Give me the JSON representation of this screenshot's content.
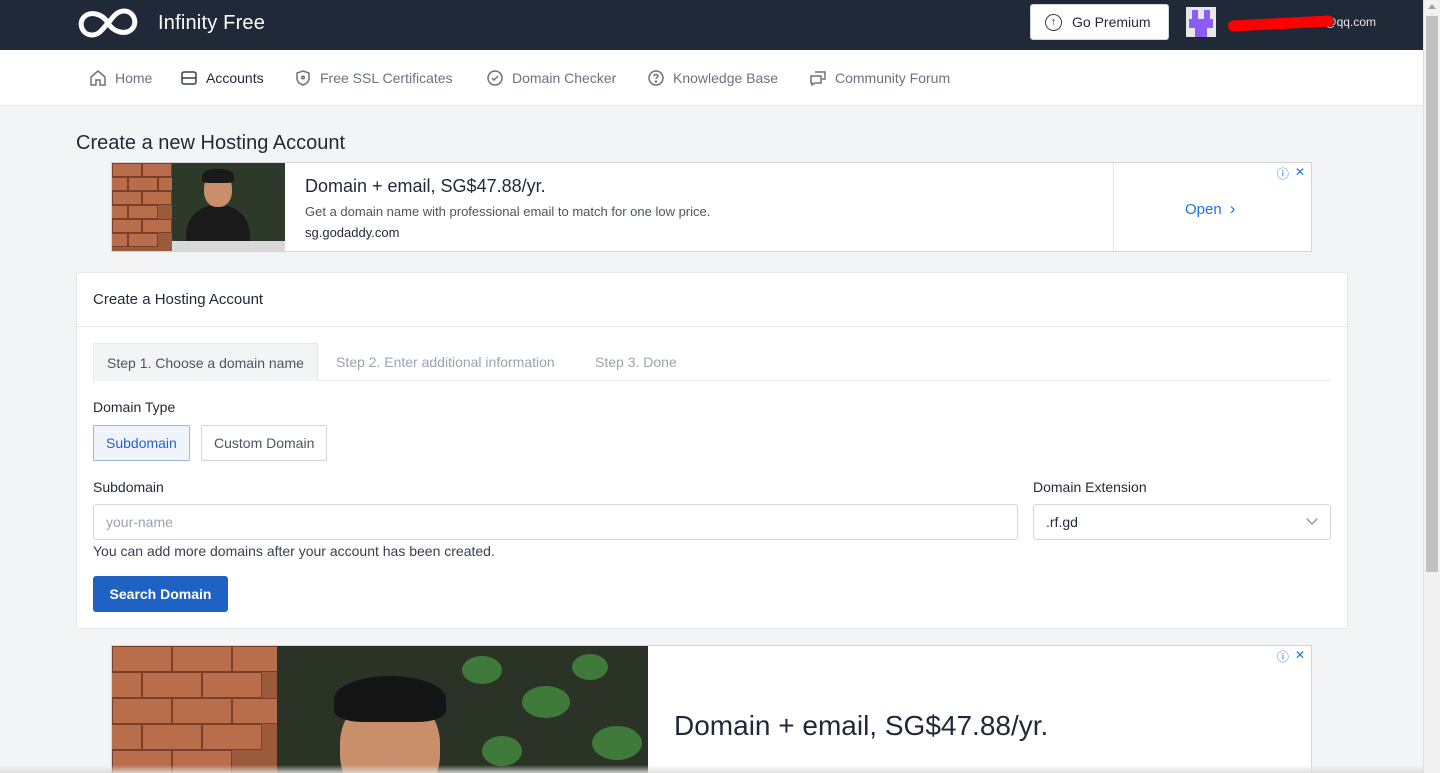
{
  "brand": {
    "name": "Infinity Free"
  },
  "header": {
    "premium_label": "Go Premium",
    "user_email": "@qq.com"
  },
  "nav": {
    "items": [
      {
        "label": "Home",
        "icon": "home-icon"
      },
      {
        "label": "Accounts",
        "icon": "accounts-icon",
        "active": true
      },
      {
        "label": "Free SSL Certificates",
        "icon": "shield-icon"
      },
      {
        "label": "Domain Checker",
        "icon": "check-circle-icon"
      },
      {
        "label": "Knowledge Base",
        "icon": "question-circle-icon"
      },
      {
        "label": "Community Forum",
        "icon": "chat-icon"
      }
    ]
  },
  "page": {
    "title": "Create a new Hosting Account"
  },
  "ad_top": {
    "title": "Domain + email, SG$47.88/yr.",
    "description": "Get a domain name with professional email to match for one low price.",
    "url": "sg.godaddy.com",
    "cta": "Open",
    "info": "ⓘ",
    "close": "✕"
  },
  "card": {
    "title": "Create a Hosting Account",
    "tabs": [
      {
        "label": "Step 1. Choose a domain name",
        "active": true
      },
      {
        "label": "Step 2. Enter additional information"
      },
      {
        "label": "Step 3. Done"
      }
    ],
    "domain_type": {
      "label": "Domain Type",
      "options": [
        "Subdomain",
        "Custom Domain"
      ],
      "selected": "Subdomain"
    },
    "subdomain": {
      "label": "Subdomain",
      "placeholder": "your-name",
      "value": ""
    },
    "extension": {
      "label": "Domain Extension",
      "value": ".rf.gd"
    },
    "help_text": "You can add more domains after your account has been created.",
    "submit_label": "Search Domain"
  },
  "ad_bottom": {
    "title": "Domain + email, SG$47.88/yr.",
    "info": "ⓘ",
    "close": "✕"
  },
  "colors": {
    "topbar": "#1f2937",
    "primary_button": "#1e63c4",
    "ad_link": "#1a73e8",
    "page_bg": "#f3f4f6"
  }
}
